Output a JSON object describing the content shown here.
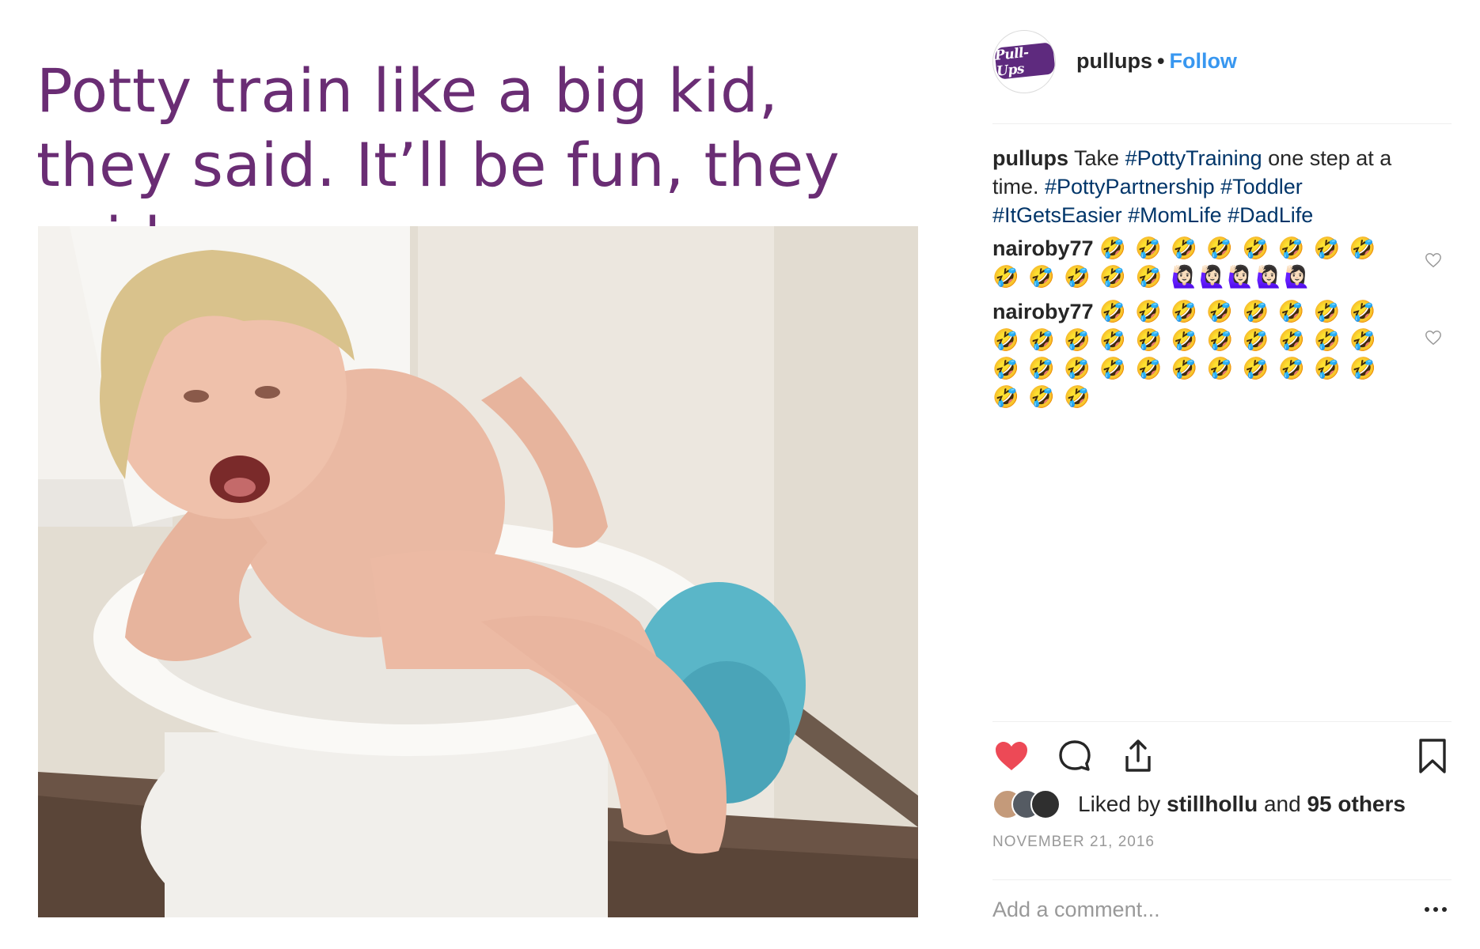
{
  "media": {
    "headline": "Potty train like a big kid, they said. It’ll be fun, they said."
  },
  "header": {
    "logo_text": "Pull-Ups",
    "username": "pullups",
    "separator": "•",
    "follow_label": "Follow"
  },
  "caption": {
    "username": "pullups",
    "text_before": "Take ",
    "tags_line1": "#PottyTraining",
    "text_mid": " one step at a time. ",
    "tags": [
      "#PottyPartnership",
      "#Toddler",
      "#ItGetsEasier",
      "#MomLife",
      "#DadLife"
    ]
  },
  "comments": [
    {
      "username": "nairoby77",
      "text": "🤣 🤣 🤣 🤣 🤣 🤣 🤣 🤣 🤣 🤣 🤣 🤣 🤣 🙋🏻‍♀️🙋🏻‍♀️🙋🏻‍♀️🙋🏻‍♀️🙋🏻‍♀️"
    },
    {
      "username": "nairoby77",
      "text": "🤣 🤣 🤣 🤣 🤣 🤣 🤣 🤣 🤣 🤣 🤣 🤣 🤣 🤣 🤣 🤣 🤣 🤣 🤣 🤣 🤣 🤣 🤣 🤣 🤣 🤣 🤣 🤣 🤣 🤣 🤣 🤣 🤣"
    }
  ],
  "actions": {
    "like_icon": "heart-filled-icon",
    "comment_icon": "comment-bubble-icon",
    "share_icon": "share-upload-icon",
    "save_icon": "bookmark-icon"
  },
  "likes": {
    "prefix": "Liked by ",
    "user": "stillhollu",
    "middle": " and ",
    "others": "95 others"
  },
  "date": "NOVEMBER 21, 2016",
  "add_comment_placeholder": "Add a comment...",
  "colors": {
    "headline": "#6a2d74",
    "follow": "#3897f0",
    "hashtag": "#003569",
    "like": "#ed4956",
    "muted": "#999999",
    "brand": "#5e2a7e"
  }
}
